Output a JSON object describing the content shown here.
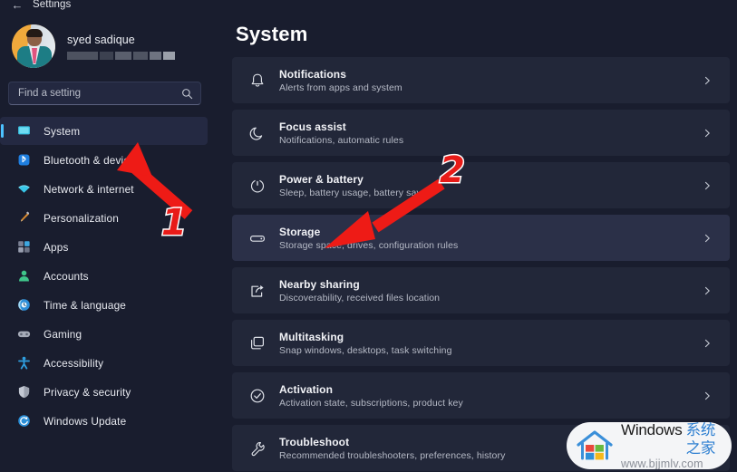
{
  "titlebar": {
    "back_icon": "back-arrow-icon",
    "title": "Settings"
  },
  "sidebar": {
    "profile": {
      "name": "syed sadique",
      "email_redacted": true,
      "avatar_icon": "user-avatar-photo"
    },
    "search": {
      "placeholder": "Find a setting",
      "value": "",
      "icon": "search-icon"
    },
    "items": [
      {
        "label": "System",
        "icon": "monitor-icon",
        "selected": true
      },
      {
        "label": "Bluetooth & devices",
        "icon": "bluetooth-icon",
        "selected": false
      },
      {
        "label": "Network & internet",
        "icon": "wifi-icon",
        "selected": false
      },
      {
        "label": "Personalization",
        "icon": "paintbrush-icon",
        "selected": false
      },
      {
        "label": "Apps",
        "icon": "apps-grid-icon",
        "selected": false
      },
      {
        "label": "Accounts",
        "icon": "person-icon",
        "selected": false
      },
      {
        "label": "Time & language",
        "icon": "clock-globe-icon",
        "selected": false
      },
      {
        "label": "Gaming",
        "icon": "gamepad-icon",
        "selected": false
      },
      {
        "label": "Accessibility",
        "icon": "accessibility-icon",
        "selected": false
      },
      {
        "label": "Privacy & security",
        "icon": "shield-icon",
        "selected": false
      },
      {
        "label": "Windows Update",
        "icon": "update-refresh-icon",
        "selected": false
      }
    ]
  },
  "main": {
    "title": "System",
    "rows": [
      {
        "title": "Notifications",
        "sub": "Alerts from apps and system",
        "icon": "bell-icon",
        "chevron": "chevron-right-icon",
        "highlight": false
      },
      {
        "title": "Focus assist",
        "sub": "Notifications, automatic rules",
        "icon": "moon-icon",
        "chevron": "chevron-right-icon",
        "highlight": false
      },
      {
        "title": "Power & battery",
        "sub": "Sleep, battery usage, battery saver",
        "icon": "power-icon",
        "chevron": "chevron-right-icon",
        "highlight": false
      },
      {
        "title": "Storage",
        "sub": "Storage space, drives, configuration rules",
        "icon": "harddrive-icon",
        "chevron": "chevron-right-icon",
        "highlight": true
      },
      {
        "title": "Nearby sharing",
        "sub": "Discoverability, received files location",
        "icon": "share-icon",
        "chevron": "chevron-right-icon",
        "highlight": false
      },
      {
        "title": "Multitasking",
        "sub": "Snap windows, desktops, task switching",
        "icon": "windows-stack-icon",
        "chevron": "chevron-right-icon",
        "highlight": false
      },
      {
        "title": "Activation",
        "sub": "Activation state, subscriptions, product key",
        "icon": "check-circle-icon",
        "chevron": "chevron-right-icon",
        "highlight": false
      },
      {
        "title": "Troubleshoot",
        "sub": "Recommended troubleshooters, preferences, history",
        "icon": "wrench-icon",
        "chevron": "chevron-right-icon",
        "highlight": false
      }
    ]
  },
  "annotations": {
    "color": "#e81b18",
    "outline_color": "#ffffff",
    "markers": [
      {
        "number": "1",
        "points_to": "System"
      },
      {
        "number": "2",
        "points_to": "Storage"
      }
    ]
  },
  "watermark": {
    "brand_en": "Windows",
    "brand_cn": "系统之家",
    "url": "www.bjjmlv.com",
    "logo_icon": "house-windows-logo-icon"
  },
  "colors": {
    "page_bg": "#191d2e",
    "card_bg": "#222739",
    "card_highlight_bg": "#2b3048",
    "accent": "#4cc2ff",
    "annotation_red": "#e81b18"
  }
}
